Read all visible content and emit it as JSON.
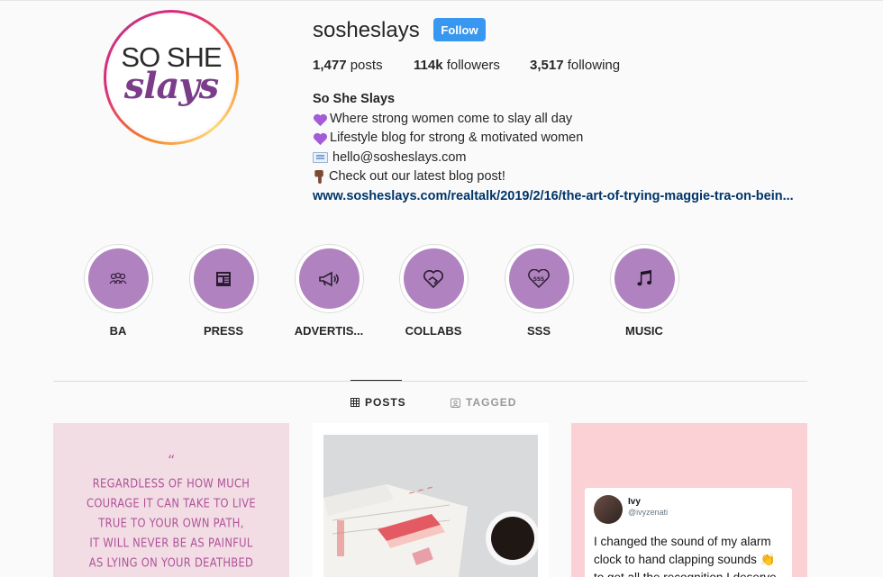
{
  "profile": {
    "username": "sosheslays",
    "follow_label": "Follow",
    "logo_text_top": "SO SHE",
    "logo_text_bottom": "slays",
    "stats": {
      "posts_count": "1,477",
      "posts_label": " posts",
      "followers_count": "114k",
      "followers_label": " followers",
      "following_count": "3,517",
      "following_label": " following"
    },
    "bio": {
      "name": "So She Slays",
      "line1": "Where strong women come to slay all day",
      "line2": "Lifestyle blog for strong & motivated women",
      "line3": "hello@sosheslays.com",
      "line4": "Check out our latest blog post!",
      "link": "www.sosheslays.com/realtalk/2019/2/16/the-art-of-trying-maggie-tra-on-bein..."
    },
    "icons": {
      "line1": "purple-heart-icon",
      "line2": "purple-heart-icon",
      "line3": "envelope-icon",
      "line4": "pointing-down-icon"
    }
  },
  "highlights": [
    {
      "label": "BA",
      "icon": "group-icon"
    },
    {
      "label": "PRESS",
      "icon": "newspaper-icon"
    },
    {
      "label": "ADVERTIS...",
      "icon": "megaphone-icon"
    },
    {
      "label": "COLLABS",
      "icon": "heart-handshake-icon"
    },
    {
      "label": "SSS",
      "icon": "sss-heart-icon"
    },
    {
      "label": "MUSIC",
      "icon": "music-notes-icon"
    }
  ],
  "tabs": {
    "posts": "POSTS",
    "tagged": "TAGGED"
  },
  "posts": {
    "post1": {
      "quote_mark": "“",
      "lines": [
        "REGARDLESS OF HOW MUCH",
        "COURAGE IT CAN TAKE TO LIVE",
        "TRUE TO YOUR OWN PATH,",
        "IT WILL NEVER BE AS PAINFUL",
        "AS LYING ON YOUR DEATHBED"
      ]
    },
    "post3": {
      "tweet_name": "Ivy",
      "tweet_handle": "@ivyzenati",
      "tweet_text": "I changed the sound of my alarm clock to hand clapping sounds 👏 to get all the recognition I deserve when I"
    }
  },
  "colors": {
    "follow_button": "#3897f0",
    "highlight_fill": "#b083c0",
    "link": "#003569",
    "logo_purple": "#7b3d8a"
  }
}
